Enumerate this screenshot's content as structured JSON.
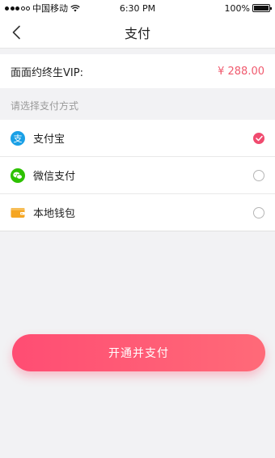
{
  "status_bar": {
    "carrier": "中国移动",
    "time": "6:30 PM",
    "battery": "100%",
    "battery_level": 1.0
  },
  "nav": {
    "title": "支付",
    "back_icon": "chevron-left-icon"
  },
  "order": {
    "label": "面面约终生VIP:",
    "price": "¥ 288.00"
  },
  "section_hint": "请选择支付方式",
  "payment_methods": [
    {
      "label": "支付宝",
      "icon": "alipay-icon",
      "selected": true
    },
    {
      "label": "微信支付",
      "icon": "wechat-pay-icon",
      "selected": false
    },
    {
      "label": "本地钱包",
      "icon": "wallet-icon",
      "selected": false
    }
  ],
  "submit_label": "开通并支付",
  "colors": {
    "accent": "#f04b6f",
    "price": "#f05a6e",
    "alipay": "#1aa0e6",
    "wechat": "#2dc100",
    "wallet": "#f5a623"
  }
}
